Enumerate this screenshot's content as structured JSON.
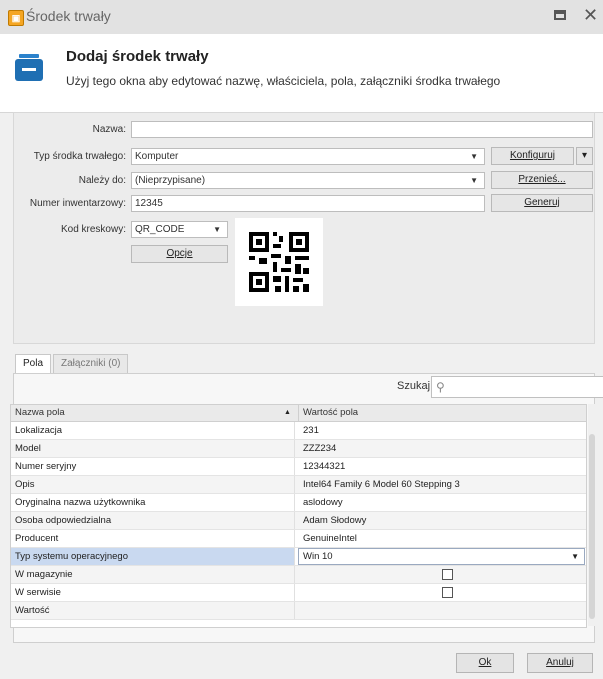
{
  "window": {
    "title": "Środek trwały"
  },
  "header": {
    "title": "Dodaj środek trwały",
    "subtitle": "Użyj tego okna aby edytować nazwę, właściciela, pola, załączniki środka trwałego"
  },
  "form": {
    "name_label": "Nazwa:",
    "name_value": "",
    "type_label": "Typ środka trwałego:",
    "type_value": "Komputer",
    "configure_label": "Konfiguruj",
    "belongs_label": "Należy do:",
    "belongs_value": "(Nieprzypisane)",
    "move_label": "Przenieś...",
    "inventory_label": "Numer inwentarzowy:",
    "inventory_value": "12345",
    "generate_label": "Generuj",
    "barcode_label": "Kod kreskowy:",
    "barcode_value": "QR_CODE",
    "options_label": "Opcje"
  },
  "tabs": [
    {
      "label": "Pola"
    },
    {
      "label": "Załączniki (0)"
    }
  ],
  "search": {
    "label": "Szukaj",
    "placeholder": ""
  },
  "grid": {
    "col_name": "Nazwa pola",
    "col_value": "Wartość pola",
    "rows": [
      {
        "name": "Lokalizacja",
        "value": "231"
      },
      {
        "name": "Model",
        "value": "ZZZ234"
      },
      {
        "name": "Numer seryjny",
        "value": "12344321"
      },
      {
        "name": "Opis",
        "value": "Intel64 Family 6 Model 60 Stepping 3"
      },
      {
        "name": "Oryginalna nazwa użytkownika",
        "value": "aslodowy"
      },
      {
        "name": "Osoba odpowiedzialna",
        "value": "Adam Słodowy"
      },
      {
        "name": "Producent",
        "value": "GenuineIntel"
      },
      {
        "name": "Typ systemu operacyjnego",
        "value": "Win 10"
      },
      {
        "name": "W magazynie",
        "value": ""
      },
      {
        "name": "W serwisie",
        "value": ""
      },
      {
        "name": "Wartość",
        "value": ""
      }
    ]
  },
  "footer": {
    "ok_label": "Ok",
    "cancel_label": "Anuluj"
  }
}
